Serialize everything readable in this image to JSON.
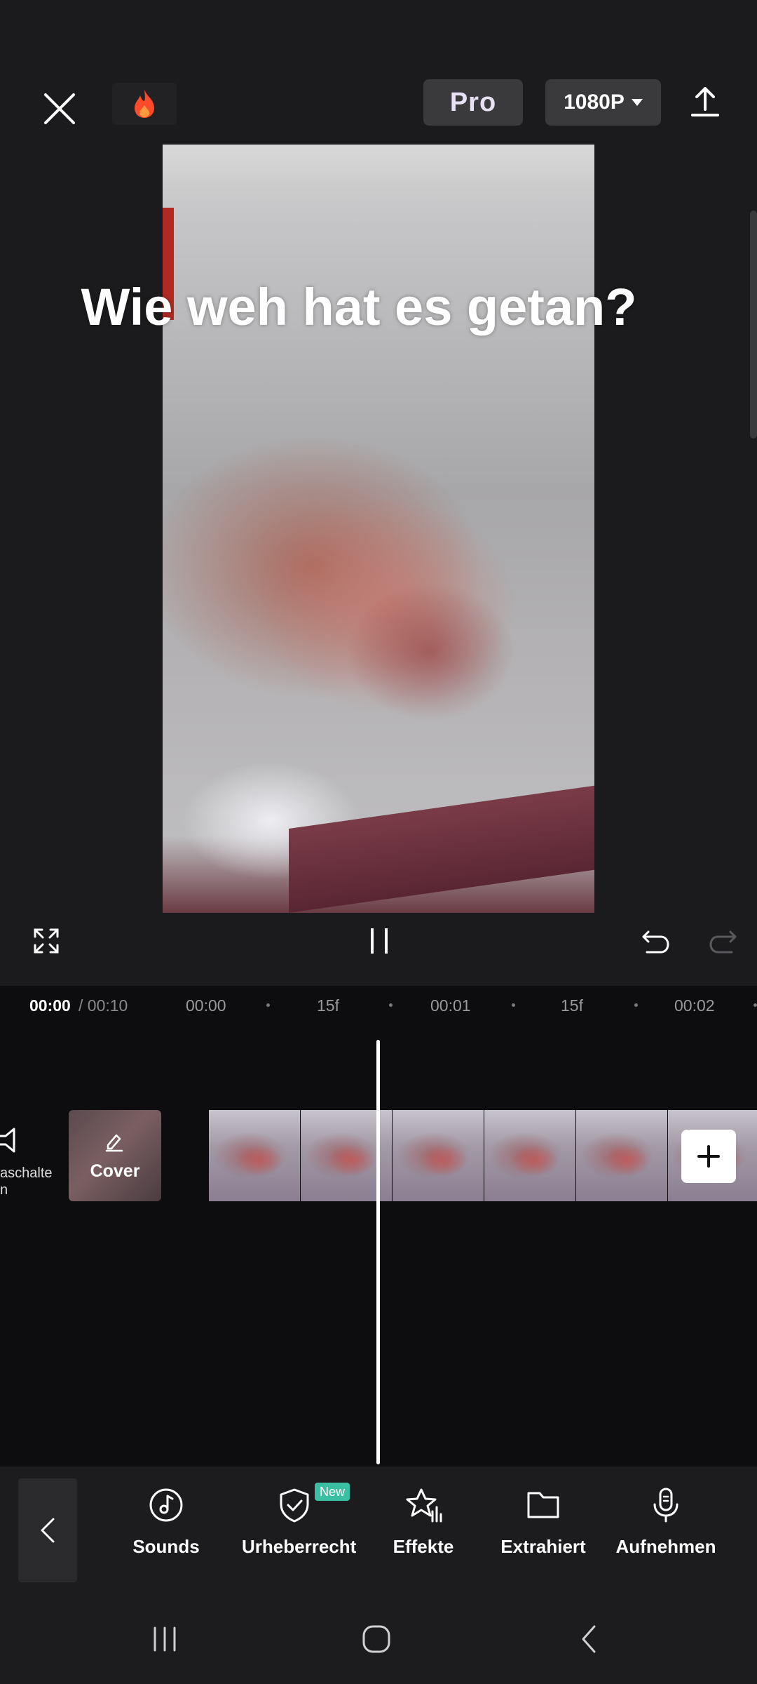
{
  "header": {
    "pro_label": "Pro",
    "resolution_label": "1080P"
  },
  "preview": {
    "caption_text": "Wie weh hat es getan?"
  },
  "timeline": {
    "current_time": "00:00",
    "total_time": "/ 00:10",
    "ruler_labels": [
      "00:00",
      "15f",
      "00:01",
      "15f",
      "00:02"
    ],
    "mute_label": "aschalte\nn",
    "cover_label": "Cover"
  },
  "toolbar": {
    "items": [
      {
        "label": "Sounds",
        "icon": "music-note-icon"
      },
      {
        "label": "Urheberrecht",
        "icon": "shield-check-icon"
      },
      {
        "label": "Effekte",
        "icon": "star-effects-icon"
      },
      {
        "label": "Extrahiert",
        "icon": "folder-icon"
      },
      {
        "label": "Aufnehmen",
        "icon": "microphone-icon"
      }
    ],
    "new_badge": "New"
  },
  "colors": {
    "background": "#1b1b1d",
    "timeline_bg": "#0d0d0f",
    "new_badge": "#3bbfa3"
  }
}
